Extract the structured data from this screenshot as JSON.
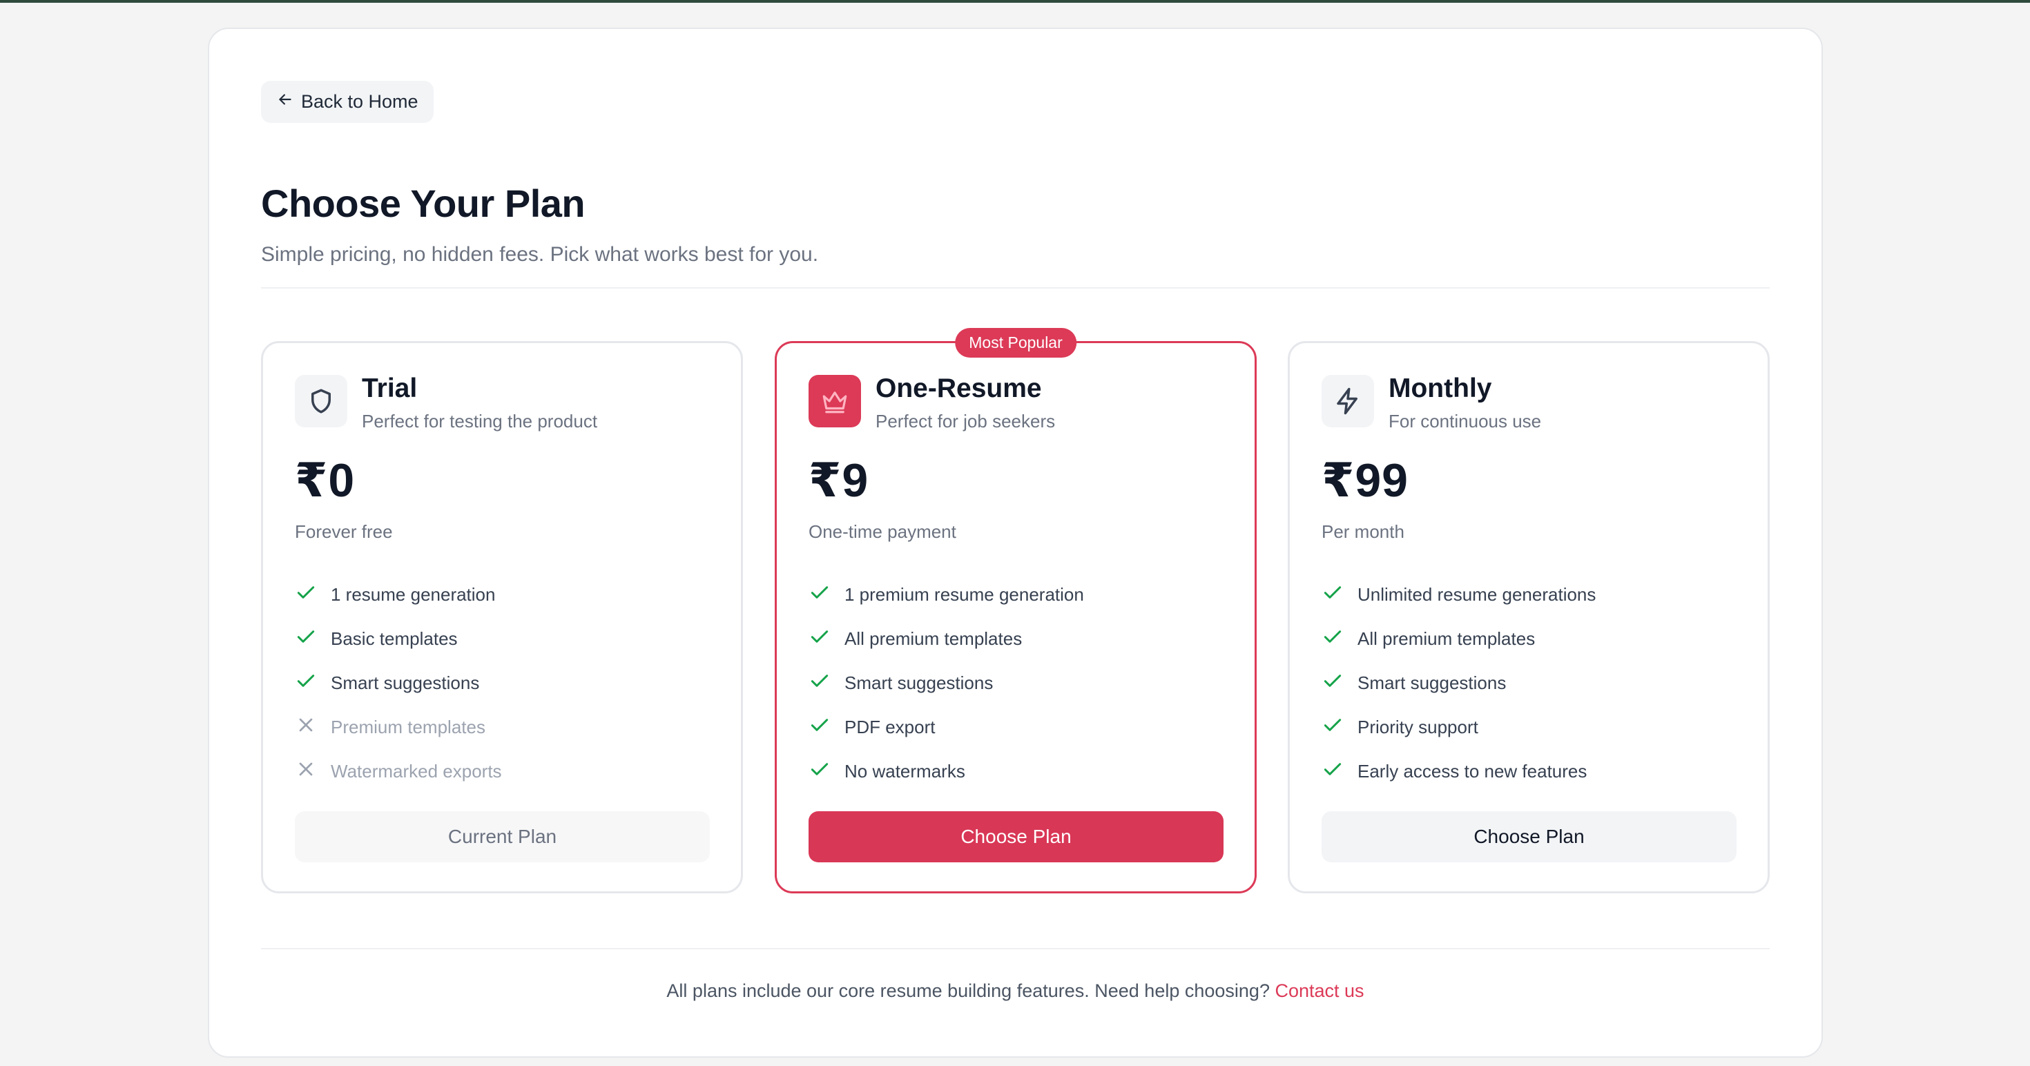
{
  "back_button": {
    "label": "Back to Home",
    "icon": "arrow-left-icon"
  },
  "header": {
    "title": "Choose Your Plan",
    "subtitle": "Simple pricing, no hidden fees. Pick what works best for you."
  },
  "plans": [
    {
      "name": "Trial",
      "description": "Perfect for testing the product",
      "icon": "shield-icon",
      "price": "₹0",
      "price_note": "Forever free",
      "features": [
        {
          "text": "1 resume generation",
          "included": true
        },
        {
          "text": "Basic templates",
          "included": true
        },
        {
          "text": "Smart suggestions",
          "included": true
        },
        {
          "text": "Premium templates",
          "included": false
        },
        {
          "text": "Watermarked exports",
          "included": false
        }
      ],
      "button_label": "Current Plan"
    },
    {
      "name": "One-Resume",
      "description": "Perfect for job seekers",
      "icon": "crown-icon",
      "badge": "Most Popular",
      "price": "₹9",
      "price_note": "One-time payment",
      "features": [
        {
          "text": "1 premium resume generation",
          "included": true
        },
        {
          "text": "All premium templates",
          "included": true
        },
        {
          "text": "Smart suggestions",
          "included": true
        },
        {
          "text": "PDF export",
          "included": true
        },
        {
          "text": "No watermarks",
          "included": true
        }
      ],
      "button_label": "Choose Plan"
    },
    {
      "name": "Monthly",
      "description": "For continuous use",
      "icon": "lightning-icon",
      "price": "₹99",
      "price_note": "Per month",
      "features": [
        {
          "text": "Unlimited resume generations",
          "included": true
        },
        {
          "text": "All premium templates",
          "included": true
        },
        {
          "text": "Smart suggestions",
          "included": true
        },
        {
          "text": "Priority support",
          "included": true
        },
        {
          "text": "Early access to new features",
          "included": true
        }
      ],
      "button_label": "Choose Plan"
    }
  ],
  "footer": {
    "text": "All plans include our core resume building features. Need help choosing?",
    "link_label": "Contact us"
  },
  "colors": {
    "accent": "#dc3a57",
    "check": "#16a34a",
    "muted": "#9ca3af"
  }
}
